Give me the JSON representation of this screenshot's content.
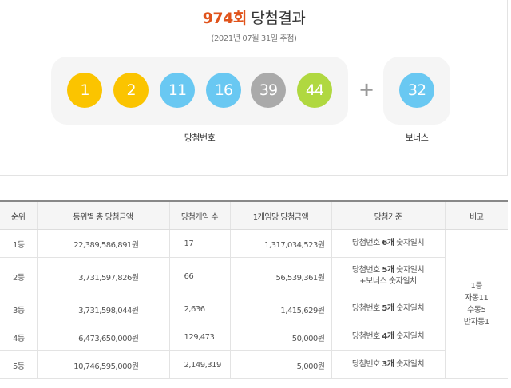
{
  "header": {
    "round": "974회",
    "title": "당첨결과",
    "date": "(2021년 07월 31일 추첨)"
  },
  "balls": [
    {
      "number": "1",
      "color": "#fbc400"
    },
    {
      "number": "2",
      "color": "#fbc400"
    },
    {
      "number": "11",
      "color": "#69c8f2"
    },
    {
      "number": "16",
      "color": "#69c8f2"
    },
    {
      "number": "39",
      "color": "#aaaaaa"
    },
    {
      "number": "44",
      "color": "#b0d840"
    }
  ],
  "bonus": {
    "number": "32",
    "color": "#69c8f2"
  },
  "plus_sign": "+",
  "labels": {
    "winning": "당첨번호",
    "bonus": "보너스"
  },
  "table": {
    "headers": [
      "순위",
      "등위별 총 당첨금액",
      "당첨게임 수",
      "1게임당 당첨금액",
      "당첨기준",
      "비고"
    ],
    "rows": [
      {
        "rank": "1등",
        "total": "22,389,586,891원",
        "winners": "17",
        "per": "1,317,034,523원",
        "crit_pre": "당첨번호 ",
        "crit_bold": "6개",
        "crit_post": " 숫자일치",
        "crit_line2": ""
      },
      {
        "rank": "2등",
        "total": "3,731,597,826원",
        "winners": "66",
        "per": "56,539,361원",
        "crit_pre": "당첨번호 ",
        "crit_bold": "5개",
        "crit_post": " 숫자일치",
        "crit_line2": "+보너스 숫자일치"
      },
      {
        "rank": "3등",
        "total": "3,731,598,044원",
        "winners": "2,636",
        "per": "1,415,629원",
        "crit_pre": "당첨번호 ",
        "crit_bold": "5개",
        "crit_post": " 숫자일치",
        "crit_line2": ""
      },
      {
        "rank": "4등",
        "total": "6,473,650,000원",
        "winners": "129,473",
        "per": "50,000원",
        "crit_pre": "당첨번호 ",
        "crit_bold": "4개",
        "crit_post": " 숫자일치",
        "crit_line2": ""
      },
      {
        "rank": "5등",
        "total": "10,746,595,000원",
        "winners": "2,149,319",
        "per": "5,000원",
        "crit_pre": "당첨번호 ",
        "crit_bold": "3개",
        "crit_post": " 숫자일치",
        "crit_line2": ""
      }
    ],
    "remark": [
      "1등",
      "자동11",
      "수동5",
      "반자동1"
    ]
  },
  "colors": {
    "accent": "#e0531b",
    "panel": "#f5f5f5"
  }
}
